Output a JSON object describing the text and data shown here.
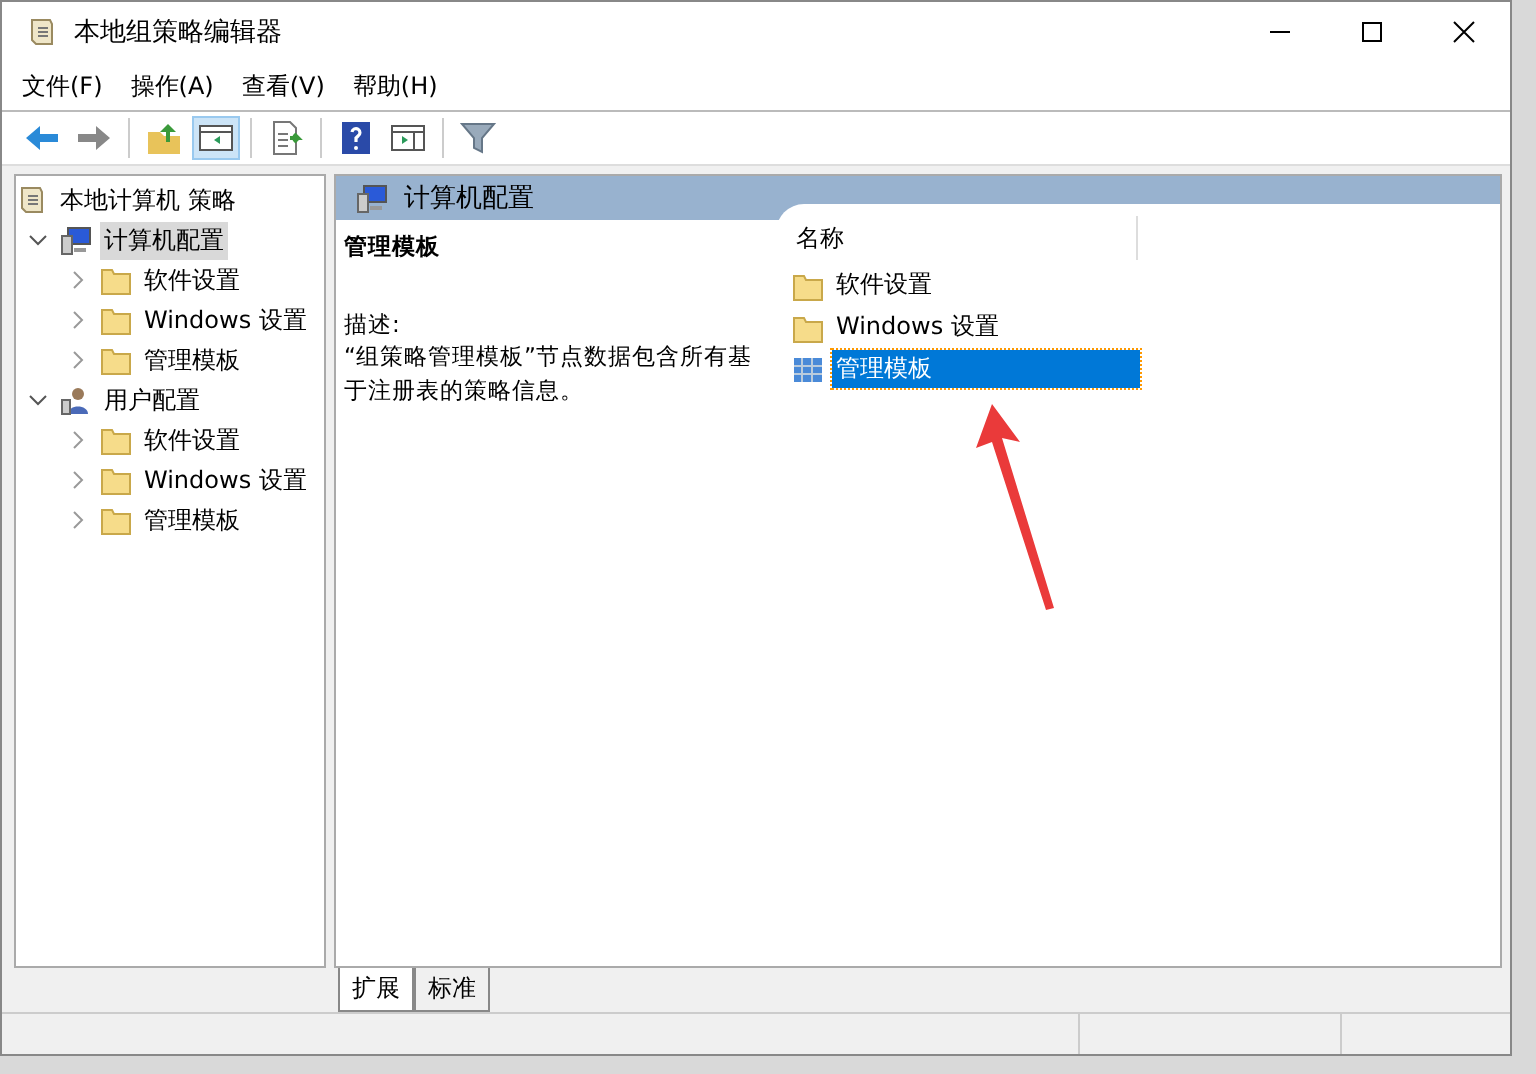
{
  "window": {
    "title": "本地组策略编辑器"
  },
  "menu": [
    "文件(F)",
    "操作(A)",
    "查看(V)",
    "帮助(H)"
  ],
  "toolbar": [
    [
      {
        "kind": "back",
        "selected": false
      },
      {
        "kind": "forward",
        "selected": false
      }
    ],
    [
      {
        "kind": "up",
        "selected": false
      },
      {
        "kind": "tree",
        "selected": true
      }
    ],
    [
      {
        "kind": "export",
        "selected": false
      }
    ],
    [
      {
        "kind": "help",
        "selected": false
      },
      {
        "kind": "pane",
        "selected": false
      }
    ],
    [
      {
        "kind": "filter",
        "selected": false
      }
    ]
  ],
  "tree": {
    "label": "本地计算机 策略",
    "children": [
      {
        "label": "计算机配置",
        "kind": "computer",
        "expanded": true,
        "selected": true,
        "children": [
          {
            "label": "软件设置",
            "expanded": false,
            "selected": false
          },
          {
            "label": "Windows 设置",
            "expanded": false,
            "selected": false
          },
          {
            "label": "管理模板",
            "expanded": false,
            "selected": false
          }
        ]
      },
      {
        "label": "用户配置",
        "kind": "user",
        "expanded": true,
        "selected": false,
        "children": [
          {
            "label": "软件设置",
            "expanded": false,
            "selected": false
          },
          {
            "label": "Windows 设置",
            "expanded": false,
            "selected": false
          },
          {
            "label": "管理模板",
            "expanded": false,
            "selected": false
          }
        ]
      }
    ]
  },
  "header": {
    "title": "计算机配置"
  },
  "description": {
    "heading": "管理模板",
    "label": "描述:",
    "text": "“组策略管理模板”节点数据包含所有基于注册表的策略信息。"
  },
  "list": {
    "column": "名称",
    "items": [
      {
        "label": "软件设置",
        "kind": "folder",
        "selected": false
      },
      {
        "label": "Windows 设置",
        "kind": "folder",
        "selected": false
      },
      {
        "label": "管理模板",
        "kind": "template",
        "selected": true
      }
    ]
  },
  "tabs": [
    {
      "label": "扩展",
      "selected": true
    },
    {
      "label": "标准",
      "selected": false
    }
  ]
}
